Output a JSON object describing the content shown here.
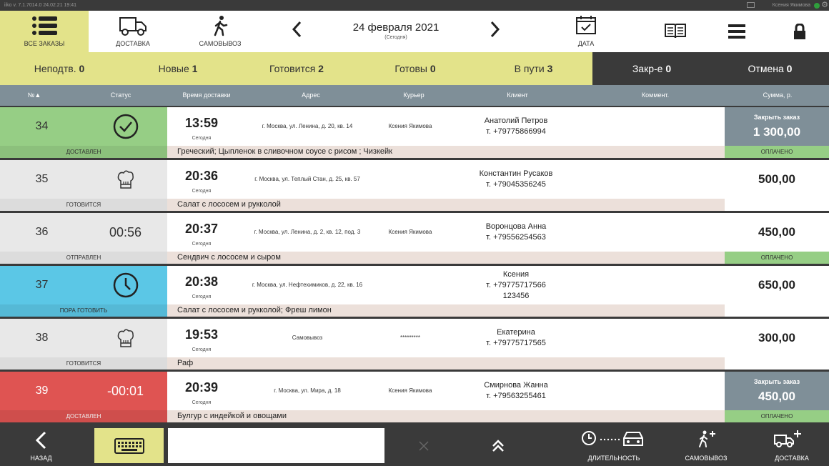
{
  "system_bar": {
    "version": "iiko v. 7.1.7014.0     24.02.21  19:41",
    "user": "Ксения Якимова"
  },
  "colors": {
    "accent": "#e3e38a",
    "green": "#96ce85",
    "blue": "#5bc7e6",
    "red": "#df5452",
    "gray_row": "#e8e8e8",
    "header": "#7f8f98",
    "dark": "#3a3a3a"
  },
  "topnav": {
    "all_orders": "ВСЕ ЗАКАЗЫ",
    "delivery": "ДОСТАВКА",
    "pickup": "САМОВЫВОЗ",
    "date": "24 февраля 2021",
    "date_sub": "(Сегодня)",
    "date_btn": "ДАТА"
  },
  "filters": [
    {
      "label": "Неподтв.",
      "count": "0"
    },
    {
      "label": "Новые",
      "count": "1"
    },
    {
      "label": "Готовится",
      "count": "2"
    },
    {
      "label": "Готовы",
      "count": "0"
    },
    {
      "label": "В пути",
      "count": "3"
    },
    {
      "label": "Закр-е",
      "count": "0"
    },
    {
      "label": "Отмена",
      "count": "0"
    }
  ],
  "columns": {
    "num": "№▲",
    "status": "Статус",
    "time": "Время доставки",
    "address": "Адрес",
    "courier": "Курьер",
    "client": "Клиент",
    "comment": "Коммент.",
    "sum": "Сумма, р."
  },
  "orders": [
    {
      "num": "34",
      "status_text": "ДОСТАВЛЕН",
      "status_icon": "check-circle-icon",
      "timer": "",
      "time": "13:59",
      "time_sub": "Сегодня",
      "address": "г. Москва, ул. Ленина, д. 20, кв. 14",
      "courier": "Ксения Якимова",
      "client_name": "Анатолий Петров",
      "client_phone": "т. +79775866994",
      "client_extra": "",
      "items": "Греческий; Цыпленок в сливочном соусе с рисом ; Чизкейк",
      "sum": "1 300,00",
      "close_label": "Закрыть заказ",
      "paid": "ОПЛАЧЕНО",
      "color": "#96ce85"
    },
    {
      "num": "35",
      "status_text": "ГОТОВИТСЯ",
      "status_icon": "chef-hat-icon",
      "timer": "",
      "time": "20:36",
      "time_sub": "Сегодня",
      "address": "г. Москва, ул. Теплый Стан, д. 25, кв. 57",
      "courier": "",
      "client_name": "Константин Русаков",
      "client_phone": "т. +79045356245",
      "client_extra": "",
      "items": "Салат с лососем и рукколой",
      "sum": "500,00",
      "close_label": "",
      "paid": "",
      "color": "#e8e8e8"
    },
    {
      "num": "36",
      "status_text": "ОТПРАВЛЕН",
      "status_icon": "",
      "timer": "00:56",
      "time": "20:37",
      "time_sub": "Сегодня",
      "address": "г. Москва, ул. Ленина, д. 2, кв. 12, под. 3",
      "courier": "Ксения Якимова",
      "client_name": "Воронцова Анна",
      "client_phone": "т. +79556254563",
      "client_extra": "",
      "items": "Сендвич с лососем и сыром",
      "sum": "450,00",
      "close_label": "",
      "paid": "ОПЛАЧЕНО",
      "color": "#e8e8e8"
    },
    {
      "num": "37",
      "status_text": "ПОРА ГОТОВИТЬ",
      "status_icon": "clock-icon",
      "timer": "",
      "time": "20:38",
      "time_sub": "Сегодня",
      "address": "г. Москва, ул. Нефтехимиков, д. 22, кв. 16",
      "courier": "",
      "client_name": "Ксения",
      "client_phone": "т. +79775717566",
      "client_extra": "123456",
      "items": "Салат с лососем и рукколой; Фреш лимон",
      "sum": "650,00",
      "close_label": "",
      "paid": "",
      "color": "#5bc7e6"
    },
    {
      "num": "38",
      "status_text": "ГОТОВИТСЯ",
      "status_icon": "chef-hat-icon",
      "timer": "",
      "time": "19:53",
      "time_sub": "Сегодня",
      "address": "Самовывоз",
      "courier": "*********",
      "client_name": "Екатерина",
      "client_phone": "т. +79775717565",
      "client_extra": "",
      "items": "Раф",
      "sum": "300,00",
      "close_label": "",
      "paid": "",
      "color": "#e8e8e8"
    },
    {
      "num": "39",
      "status_text": "ДОСТАВЛЕН",
      "status_icon": "",
      "timer": "-00:01",
      "time": "20:39",
      "time_sub": "Сегодня",
      "address": "г. Москва, ул. Мира, д. 18",
      "courier": "Ксения Якимова",
      "client_name": "Смирнова Жанна",
      "client_phone": "т. +79563255461",
      "client_extra": "",
      "items": "Булгур с индейкой и овощами",
      "sum": "450,00",
      "close_label": "Закрыть заказ",
      "paid": "ОПЛАЧЕНО",
      "color": "#df5452"
    }
  ],
  "bottom": {
    "back": "НАЗАД",
    "search_placeholder": "",
    "duration": "ДЛИТЕЛЬНОСТЬ",
    "new_pickup": "САМОВЫВОЗ",
    "new_delivery": "ДОСТАВКА"
  }
}
